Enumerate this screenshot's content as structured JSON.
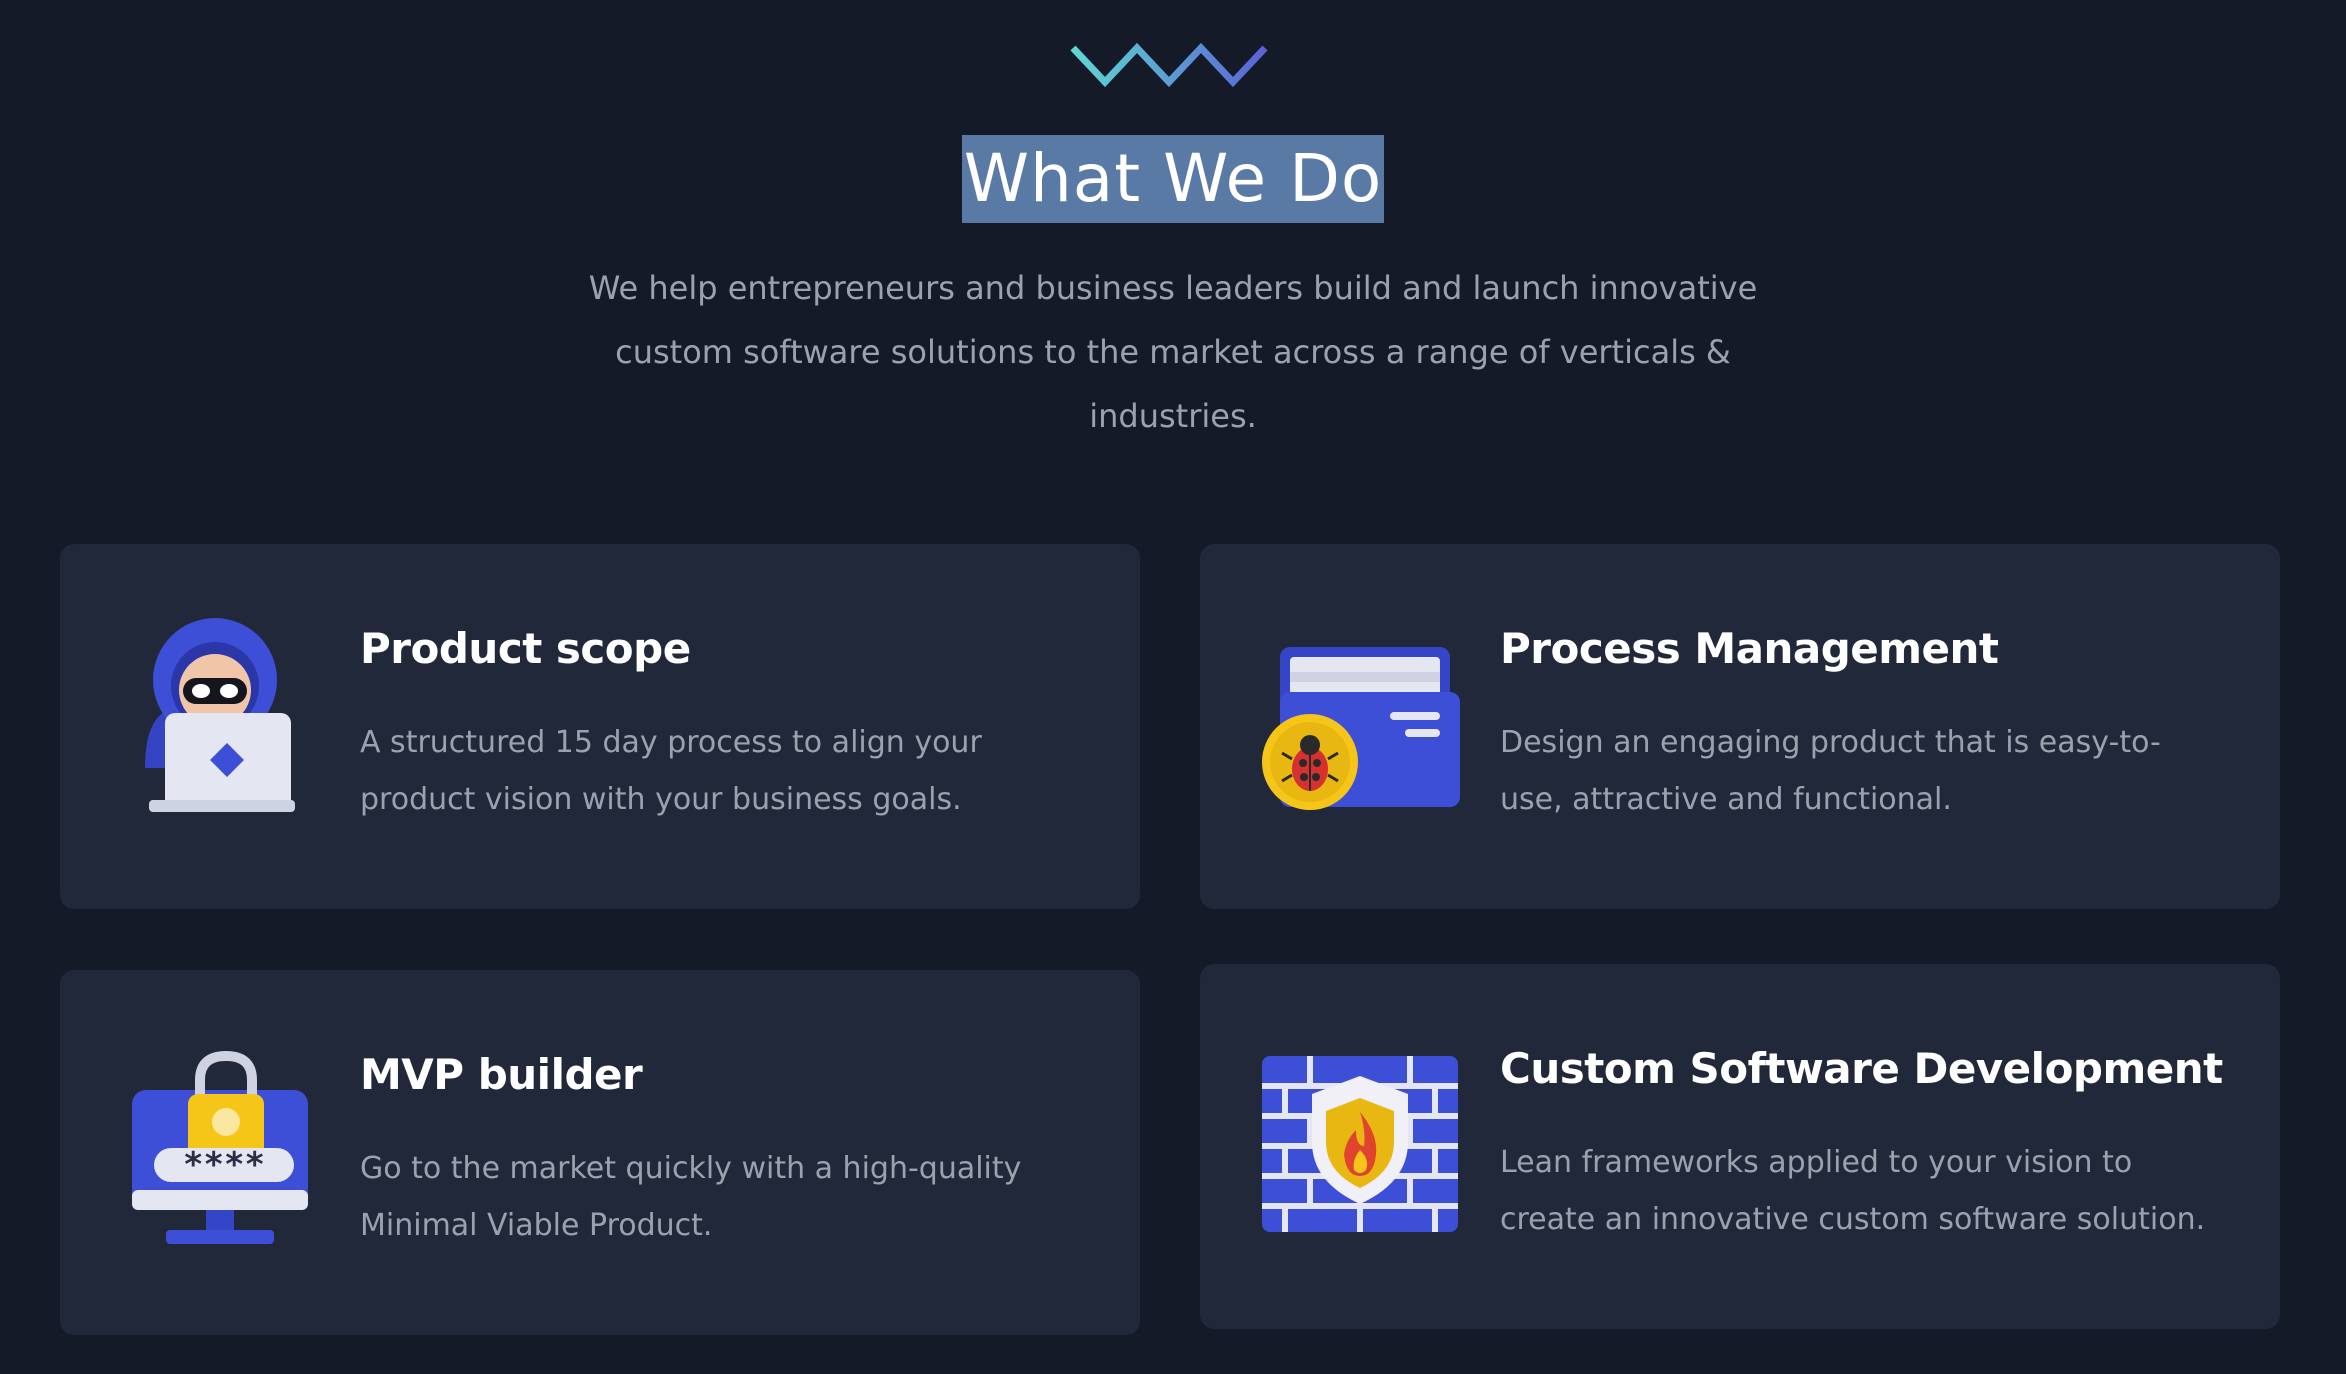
{
  "section": {
    "title": "What We Do",
    "intro": "We help entrepreneurs and business leaders build and launch innovative custom software solutions to the market across a range of verticals & industries."
  },
  "cards": [
    {
      "title": "Product scope",
      "description": "A structured 15 day process to align your product vision with your business goals.",
      "icon": "hooded-hacker-laptop-icon"
    },
    {
      "title": "Process Management",
      "description": "Design an engaging product that is easy-to-use, attractive and functional.",
      "icon": "folder-bug-icon"
    },
    {
      "title": "MVP builder",
      "description": "Go to the market quickly with a high-quality Minimal Viable Product.",
      "icon": "monitor-password-lock-icon",
      "password_mask": "****"
    },
    {
      "title": "Custom Software Development",
      "description": "Lean frameworks applied to your vision to create an innovative custom software solution.",
      "icon": "firewall-shield-icon"
    }
  ],
  "colors": {
    "background": "#141a27",
    "card": "#20283a",
    "title_highlight": "#5a7aa6",
    "accent_blue": "#3d4fd6",
    "accent_yellow": "#f5c518",
    "wave_start": "#5fd8d2",
    "wave_end": "#5a63d6"
  }
}
